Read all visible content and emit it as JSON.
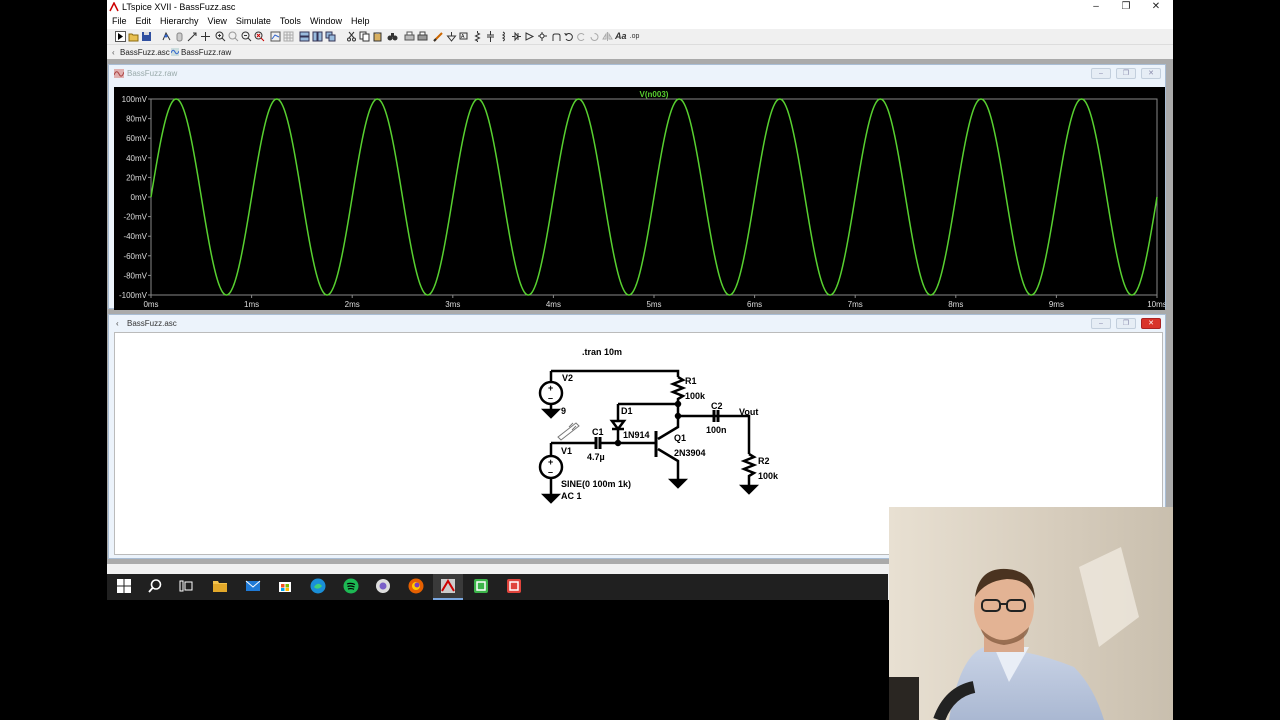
{
  "window": {
    "title": "LTspice XVII - BassFuzz.asc",
    "controls": [
      "–",
      "❐",
      "✕"
    ]
  },
  "menu": [
    "File",
    "Edit",
    "Hierarchy",
    "View",
    "Simulate",
    "Tools",
    "Window",
    "Help"
  ],
  "tabs": [
    {
      "label": "BassFuzz.asc",
      "icon": "schematic-icon"
    },
    {
      "label": "BassFuzz.raw",
      "icon": "waveform-icon"
    }
  ],
  "waveform_window": {
    "title": "BassFuzz.raw",
    "trace_label": "V(n003)",
    "trace_color": "#58d030"
  },
  "schematic_window": {
    "title": "BassFuzz.asc",
    "directive": ".tran 10m",
    "components": {
      "v2_name": "V2",
      "v2_value": "9",
      "v1_name": "V1",
      "v1_value": "SINE(0 100m 1k)",
      "v1_ac": "AC 1",
      "r1_name": "R1",
      "r1_value": "100k",
      "r2_name": "R2",
      "r2_value": "100k",
      "c1_name": "C1",
      "c1_value": "4.7µ",
      "c2_name": "C2",
      "c2_value": "100n",
      "d1_name": "D1",
      "d1_value": "1N914",
      "q1_name": "Q1",
      "q1_value": "2N3904",
      "vout_label": "Vout"
    }
  },
  "chart_data": {
    "type": "line",
    "title": "V(n003)",
    "xlabel": "",
    "ylabel": "",
    "x_ticks": [
      "0ms",
      "1ms",
      "2ms",
      "3ms",
      "4ms",
      "5ms",
      "6ms",
      "7ms",
      "8ms",
      "9ms",
      "10ms"
    ],
    "y_ticks": [
      "100mV",
      "80mV",
      "60mV",
      "40mV",
      "20mV",
      "0mV",
      "-20mV",
      "-40mV",
      "-60mV",
      "-80mV",
      "-100mV"
    ],
    "xlim_ms": [
      0,
      10
    ],
    "ylim_mV": [
      -100,
      100
    ],
    "series": [
      {
        "name": "V(n003)",
        "function": "sine",
        "amplitude_mV": 100,
        "frequency_kHz": 1,
        "offset_mV": 0,
        "color": "#58d030"
      }
    ],
    "background": "#000000",
    "grid": false
  },
  "taskbar": {
    "icons": [
      "windows-start-icon",
      "search-icon",
      "task-view-icon",
      "file-explorer-icon",
      "mail-icon",
      "store-icon",
      "edge-icon",
      "spotify-icon",
      "app-icon",
      "firefox-icon",
      "ltspice-icon",
      "camtasia-recorder-icon",
      "camtasia-icon"
    ]
  }
}
